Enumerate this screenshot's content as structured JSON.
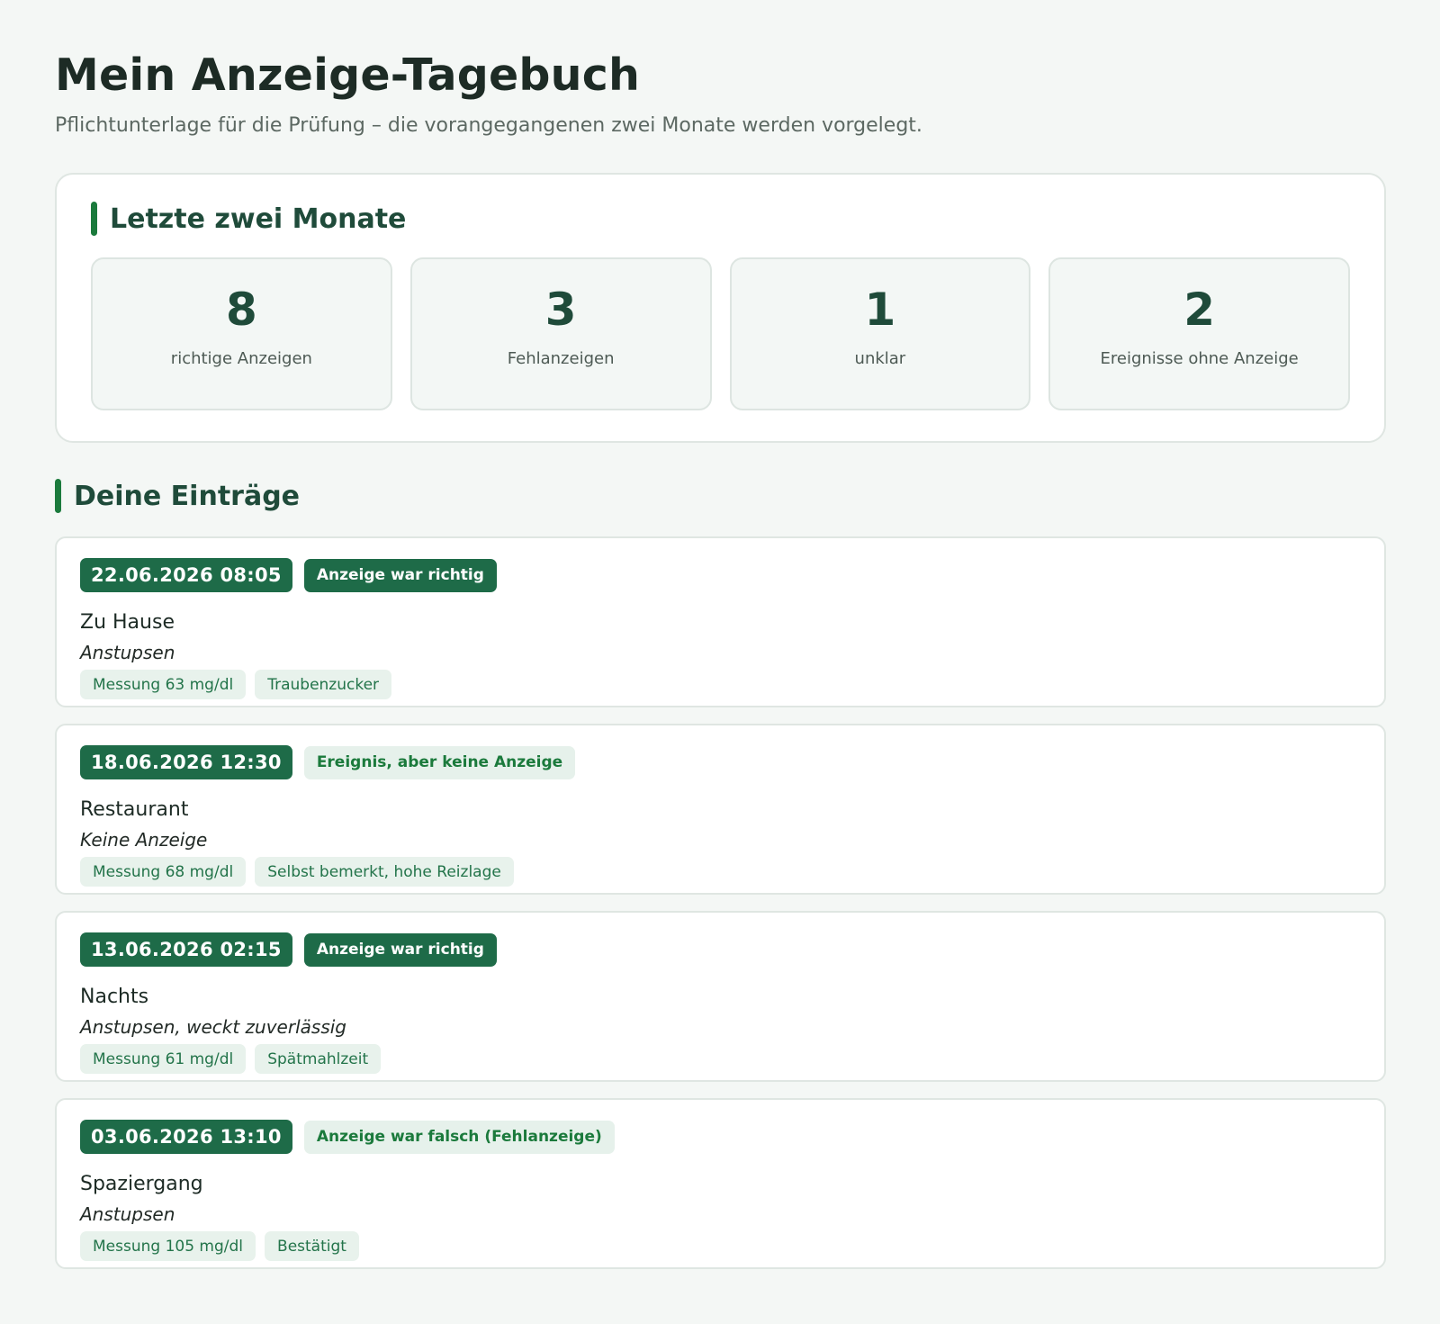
{
  "header": {
    "title": "Mein Anzeige-Tagebuch",
    "subtitle": "Pflichtunterlage für die Prüfung – die vorangegangenen zwei Monate werden vorgelegt."
  },
  "summary": {
    "heading": "Letzte zwei Monate",
    "stats": [
      {
        "value": "8",
        "label": "richtige Anzeigen"
      },
      {
        "value": "3",
        "label": "Fehlanzeigen"
      },
      {
        "value": "1",
        "label": "unklar"
      },
      {
        "value": "2",
        "label": "Ereignisse ohne Anzeige"
      }
    ]
  },
  "entries_section": {
    "heading": "Deine Einträge",
    "entries": [
      {
        "datetime": "22.06.2026 08:05",
        "status": "Anzeige war richtig",
        "place": "Zu Hause",
        "type": "Anstupsen",
        "tags": [
          "Messung 63 mg/dl",
          "Traubenzucker"
        ]
      },
      {
        "datetime": "18.06.2026 12:30",
        "status": "Ereignis, aber keine Anzeige",
        "place": "Restaurant",
        "type": "Keine Anzeige",
        "tags": [
          "Messung 68 mg/dl",
          "Selbst bemerkt, hohe Reizlage"
        ]
      },
      {
        "datetime": "13.06.2026 02:15",
        "status": "Anzeige war richtig",
        "place": "Nachts",
        "type": "Anstupsen, weckt zuverlässig",
        "tags": [
          "Messung 61 mg/dl",
          "Spätmahlzeit"
        ]
      },
      {
        "datetime": "03.06.2026 13:10",
        "status": "Anzeige war falsch (Fehlanzeige)",
        "place": "Spaziergang",
        "type": "Anstupsen",
        "tags": [
          "Messung 105 mg/dl",
          "Bestätigt"
        ]
      }
    ]
  },
  "colors": {
    "accent": "#1b7a3c",
    "badge_dark": "#1e6b48",
    "badge_light": "#e6f1eb"
  }
}
